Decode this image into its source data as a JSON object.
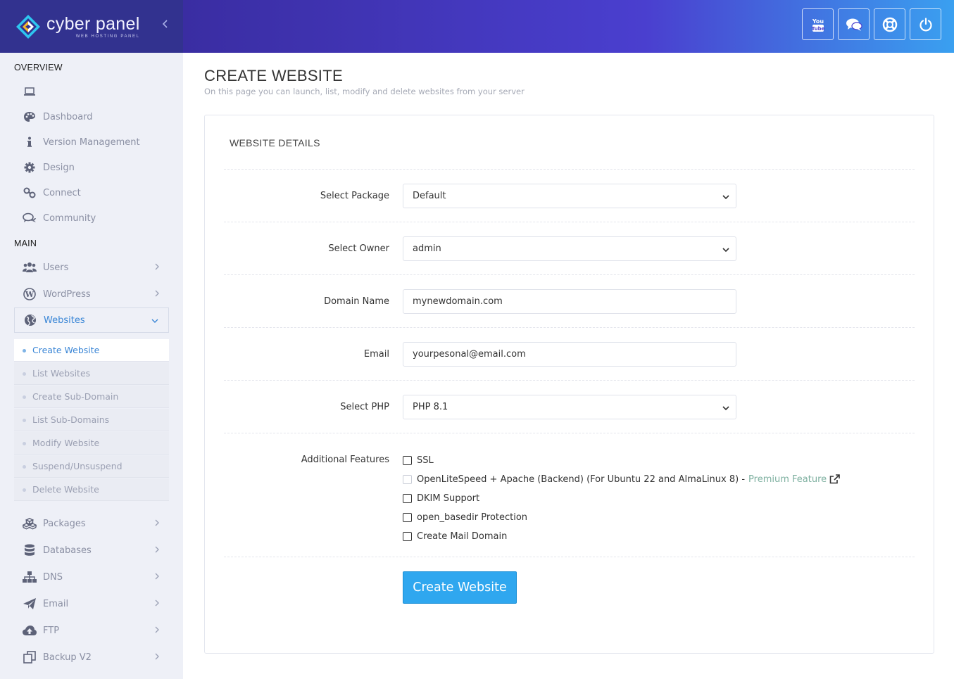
{
  "brand": {
    "title": "cyber panel",
    "subtitle": "WEB HOSTING PANEL"
  },
  "header": {
    "collapse_icon": "chevron-left-icon",
    "actions": [
      {
        "name": "youtube-button",
        "icon": "youtube-icon"
      },
      {
        "name": "chat-button",
        "icon": "chat-icon"
      },
      {
        "name": "support-button",
        "icon": "lifebuoy-icon"
      },
      {
        "name": "logout-button",
        "icon": "power-icon"
      }
    ]
  },
  "sidebar": {
    "overview_label": "OVERVIEW",
    "main_label": "MAIN",
    "overview_items": [
      {
        "label": "",
        "icon": "laptop-icon"
      },
      {
        "label": "Dashboard",
        "icon": "palette-icon"
      },
      {
        "label": "Version Management",
        "icon": "info-icon"
      },
      {
        "label": "Design",
        "icon": "gear-icon"
      },
      {
        "label": "Connect",
        "icon": "link-icon"
      },
      {
        "label": "Community",
        "icon": "comments-icon"
      }
    ],
    "main_items": [
      {
        "label": "Users",
        "icon": "users-icon"
      },
      {
        "label": "WordPress",
        "icon": "wordpress-icon"
      },
      {
        "label": "Websites",
        "icon": "globe-icon"
      }
    ],
    "websites_submenu": [
      "Create Website",
      "List Websites",
      "Create Sub-Domain",
      "List Sub-Domains",
      "Modify Website",
      "Suspend/Unsuspend",
      "Delete Website"
    ],
    "more_items": [
      {
        "label": "Packages",
        "icon": "cubes-icon"
      },
      {
        "label": "Databases",
        "icon": "database-icon"
      },
      {
        "label": "DNS",
        "icon": "sitemap-icon"
      },
      {
        "label": "Email",
        "icon": "paper-plane-icon"
      },
      {
        "label": "FTP",
        "icon": "cloud-upload-icon"
      },
      {
        "label": "Backup V2",
        "icon": "copy-icon"
      }
    ]
  },
  "page": {
    "title": "CREATE WEBSITE",
    "subtitle": "On this page you can launch, list, modify and delete websites from your server"
  },
  "form": {
    "panel_title": "WEBSITE DETAILS",
    "package_label": "Select Package",
    "package_value": "Default",
    "owner_label": "Select Owner",
    "owner_value": "admin",
    "domain_label": "Domain Name",
    "domain_value": "mynewdomain.com",
    "email_label": "Email",
    "email_value": "yourpesonal@email.com",
    "php_label": "Select PHP",
    "php_value": "PHP 8.1",
    "features_label": "Additional Features",
    "features": {
      "ssl": "SSL",
      "ols_apache": "OpenLiteSpeed + Apache (Backend) (For Ubuntu 22 and AlmaLinux 8) -",
      "premium": "Premium Feature",
      "dkim": "DKIM Support",
      "basedir": "open_basedir Protection",
      "mail": "Create Mail Domain"
    },
    "submit_label": "Create Website"
  },
  "colors": {
    "sidebar_bg": "#eef0f7",
    "logo_bg": "#32328f",
    "accent": "#3a86d6",
    "button": "#2fa7ef"
  }
}
